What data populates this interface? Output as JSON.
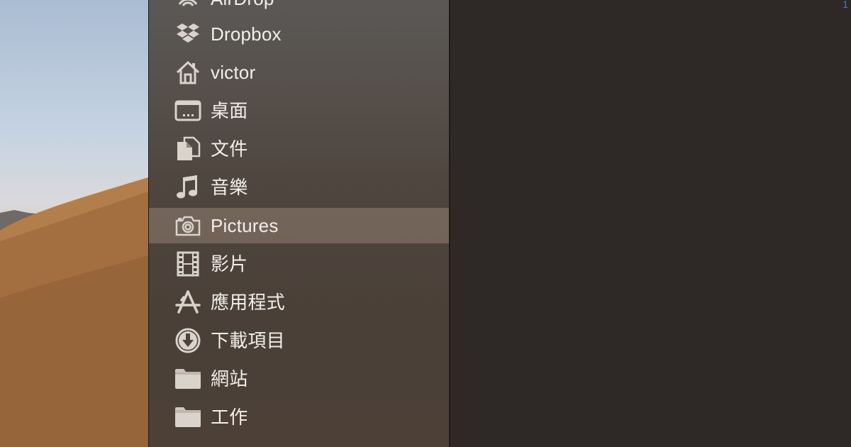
{
  "sidebar": {
    "items": [
      {
        "label": "AirDrop",
        "icon": "airdrop-icon"
      },
      {
        "label": "Dropbox",
        "icon": "dropbox-icon"
      },
      {
        "label": "victor",
        "icon": "home-icon"
      },
      {
        "label": "桌面",
        "icon": "desktop-icon"
      },
      {
        "label": "文件",
        "icon": "documents-icon"
      },
      {
        "label": "音樂",
        "icon": "music-icon"
      },
      {
        "label": "Pictures",
        "icon": "camera-icon",
        "selected": true
      },
      {
        "label": "影片",
        "icon": "film-icon"
      },
      {
        "label": "應用程式",
        "icon": "applications-icon"
      },
      {
        "label": "下載項目",
        "icon": "download-icon"
      },
      {
        "label": "網站",
        "icon": "folder-icon"
      },
      {
        "label": "工作",
        "icon": "folder-icon"
      }
    ]
  },
  "content": {
    "corner_number": "1"
  },
  "colors": {
    "selection": "#7a6b60",
    "icon": "#d9d3cc",
    "label": "#f2eeea",
    "content_bg": "#2e2926",
    "accent": "#3e7ad9"
  }
}
